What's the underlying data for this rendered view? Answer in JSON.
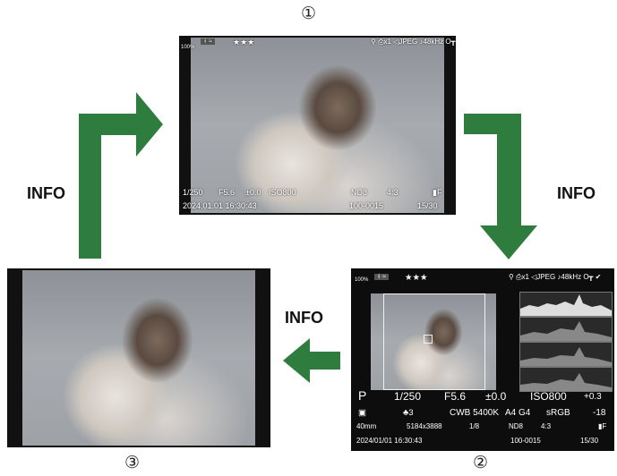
{
  "step_numbers": {
    "one": "①",
    "two": "②",
    "three": "③"
  },
  "info_labels": {
    "left": "INFO",
    "right": "INFO",
    "middle": "INFO"
  },
  "screen1": {
    "battery": "100%",
    "stars": "★★★",
    "top_right": [
      "⚲",
      "⎙x1",
      "◁JPEG",
      "♪48kHz",
      "O┳",
      "✔"
    ],
    "bottom_row1": [
      "1/250",
      "F5.6",
      "±0.0",
      "ISO800",
      "ND8",
      "4:3",
      "▮F"
    ],
    "bottom_row2_left": "2024.01.01  16:30:43",
    "bottom_row2_mid": "100-0015",
    "bottom_row2_right": "15/30"
  },
  "screen2": {
    "battery": "100%",
    "stars": "★★★",
    "top_right": "⚲  ⎙x1  ◁JPEG ♪48kHz O┳ ✔",
    "row1": [
      "P",
      "1/250",
      "F5.6",
      "±0.0",
      "ISO800",
      "+0.3"
    ],
    "row2": [
      "▣",
      "♣3",
      "CWB 5400K",
      "A4  G4",
      "sRGB",
      "-18"
    ],
    "row3": [
      "40mm",
      "5184x3888",
      "1/8",
      "ND8",
      "4:3",
      "▮F"
    ],
    "row4": [
      "2024/01/01  16:30:43",
      "100-0015",
      "15/30"
    ]
  },
  "colors": {
    "arrow": "#2e7d3e",
    "screen_bg": "#111111",
    "highlight_box": "#f0f0f0"
  }
}
